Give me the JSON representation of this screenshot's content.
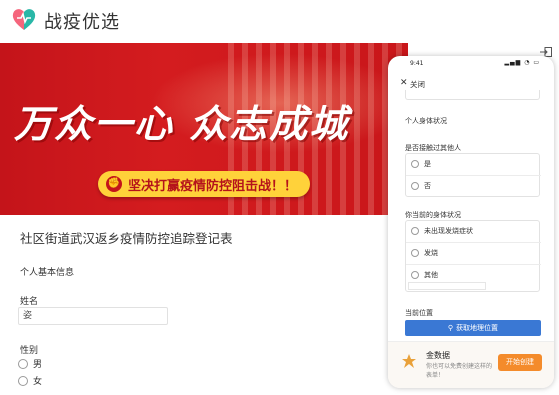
{
  "brand": {
    "name": "战疫优选",
    "logo_icon": "heart-logo-icon",
    "colors": {
      "logo_pink": "#f5657c",
      "logo_teal": "#29b7a7"
    }
  },
  "banner": {
    "slogan_main": "万众一心 众志成城",
    "slogan_sub": "坚决打赢疫情防控阻击战！！",
    "fist_icon": "fist-icon",
    "colors": {
      "red": "#c4141a",
      "yellow": "#ffd23a"
    }
  },
  "form": {
    "title": "社区街道武汉返乡疫情防控追踪登记表",
    "section_basic": "个人基本信息",
    "name_label": "姓名",
    "name_value": "姿",
    "gender_label": "性别",
    "gender_options": [
      "男",
      "女"
    ]
  },
  "phone": {
    "status_time": "9:41",
    "status_icons": "signal-wifi-battery-icons",
    "close_label": "关闭",
    "section_health": "个人身体状况",
    "contact_question": "是否接触过其他人",
    "contact_options": [
      "是",
      "否"
    ],
    "condition_question": "你当前的身体状况",
    "condition_options": [
      "未出现发烧症状",
      "发烧",
      "其他"
    ],
    "location_label": "当前位置",
    "location_button": "获取地理位置",
    "ad_name": "金数据",
    "ad_desc": "你也可以免费创建这样的表单！",
    "ad_button": "开始创建",
    "colors": {
      "location_blue": "#3a78d4",
      "start_orange": "#f48b2b"
    }
  },
  "exit_icon": "exit-fullscreen-icon"
}
